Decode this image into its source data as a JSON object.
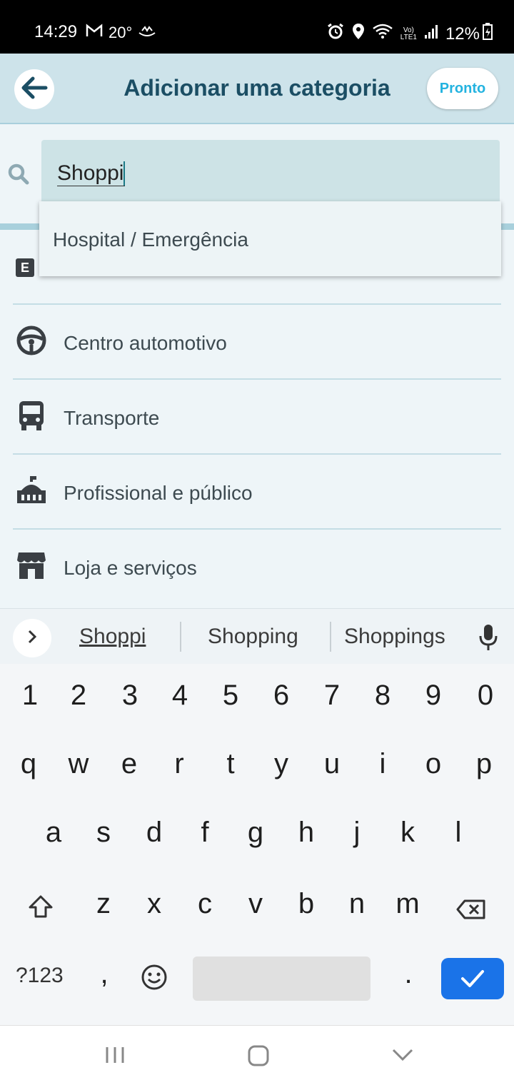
{
  "status_bar": {
    "time": "14:29",
    "temp": "20°",
    "battery": "12%",
    "icons": [
      "gmail-icon",
      "weather-icon",
      "alarm-icon",
      "location-icon",
      "wifi-icon",
      "volte-icon",
      "signal-icon",
      "battery-charging-icon"
    ]
  },
  "header": {
    "title": "Adicionar uma categoria",
    "done_label": "Pronto",
    "back_icon": "arrow-left-icon"
  },
  "search": {
    "value": "Shoppi",
    "icon": "search-icon"
  },
  "dropdown": {
    "items": [
      {
        "label": "Hospital / Emergência"
      }
    ]
  },
  "partial_row_icon_letter": "E",
  "categories": [
    {
      "label": "Centro automotivo",
      "icon": "steering-wheel-icon"
    },
    {
      "label": "Transporte",
      "icon": "bus-icon"
    },
    {
      "label": "Profissional e público",
      "icon": "government-building-icon"
    },
    {
      "label": "Loja e serviços",
      "icon": "store-icon"
    }
  ],
  "suggestions": {
    "items": [
      "Shoppi",
      "Shopping",
      "Shoppings"
    ],
    "expand_icon": "chevron-right-icon",
    "mic_icon": "microphone-icon"
  },
  "keyboard": {
    "numbers": [
      "1",
      "2",
      "3",
      "4",
      "5",
      "6",
      "7",
      "8",
      "9",
      "0"
    ],
    "row1": [
      "q",
      "w",
      "e",
      "r",
      "t",
      "y",
      "u",
      "i",
      "o",
      "p"
    ],
    "row2": [
      "a",
      "s",
      "d",
      "f",
      "g",
      "h",
      "j",
      "k",
      "l"
    ],
    "row3": [
      "z",
      "x",
      "c",
      "v",
      "b",
      "n",
      "m"
    ],
    "symbols_label": "?123",
    "comma": ",",
    "period": ".",
    "enter_color": "#1a73e8"
  },
  "navbar": {
    "icons": [
      "recent-apps-icon",
      "home-icon",
      "back-chevron-icon"
    ]
  },
  "colors": {
    "header_bg": "#cde3ea",
    "title": "#1b4e64",
    "accent": "#23b3e0"
  }
}
